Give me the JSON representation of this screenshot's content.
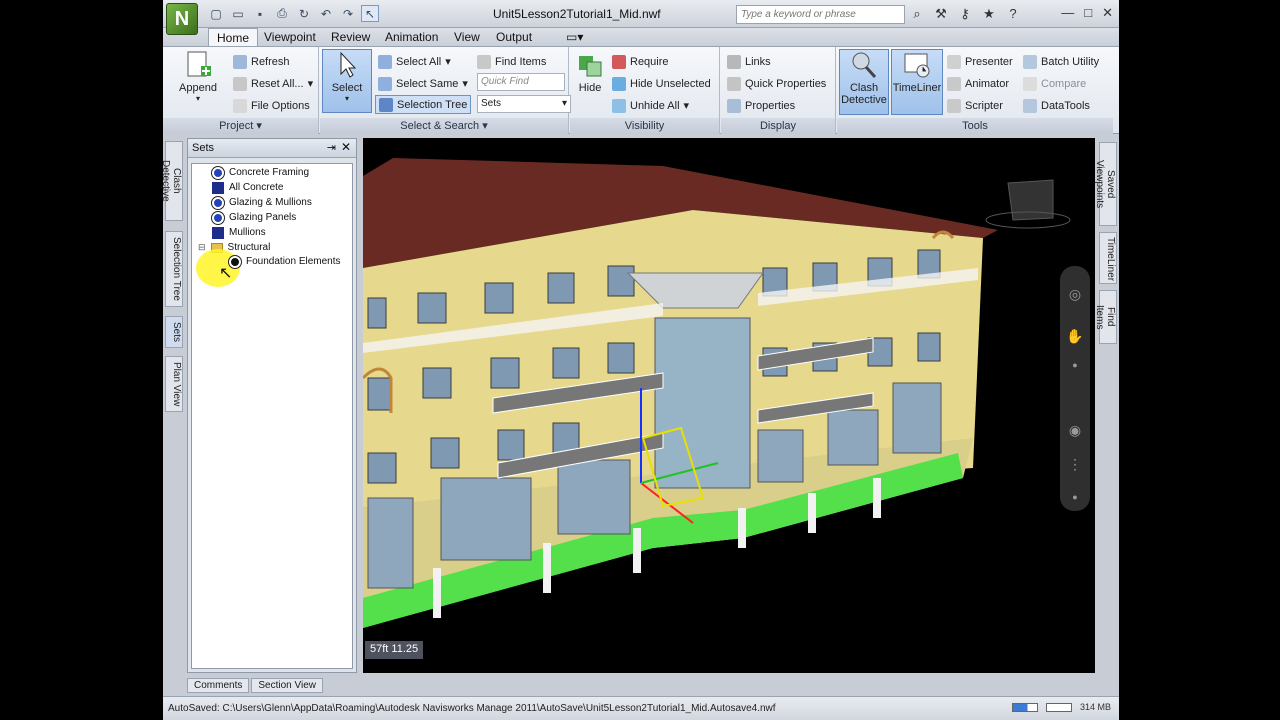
{
  "window": {
    "title": "Unit5Lesson2Tutorial1_Mid.nwf",
    "app_logo": "N",
    "search_placeholder": "Type a keyword or phrase",
    "quick_access": [
      "new-icon",
      "open-icon",
      "save-icon",
      "print-icon",
      "refresh-icon",
      "undo-icon",
      "redo-icon",
      "select-icon"
    ],
    "controls": {
      "minimize": "—",
      "maximize": "□",
      "close": "✕"
    }
  },
  "ribbon": {
    "tabs": [
      "Home",
      "Viewpoint",
      "Review",
      "Animation",
      "View",
      "Output"
    ],
    "active_tab": "Home",
    "panels": {
      "project": {
        "title": "Project",
        "append": "Append",
        "refresh": "Refresh",
        "reset_all": "Reset All...",
        "file_options": "File Options"
      },
      "select_search": {
        "title": "Select & Search",
        "select": "Select",
        "select_all": "Select All",
        "select_same": "Select Same",
        "selection_tree": "Selection Tree",
        "find_items": "Find Items",
        "quick_find_placeholder": "Quick Find",
        "sets": "Sets"
      },
      "visibility": {
        "title": "Visibility",
        "hide": "Hide",
        "require": "Require",
        "hide_unselected": "Hide Unselected",
        "unhide_all": "Unhide All"
      },
      "display": {
        "title": "Display",
        "links": "Links",
        "quick_properties": "Quick Properties",
        "properties": "Properties"
      },
      "tools": {
        "title": "Tools",
        "clash_detective_1": "Clash",
        "clash_detective_2": "Detective",
        "timeliner": "TimeLiner",
        "presenter": "Presenter",
        "animator": "Animator",
        "scripter": "Scripter",
        "batch_utility": "Batch Utility",
        "compare": "Compare",
        "datatools": "DataTools"
      }
    }
  },
  "left_dock_tabs": [
    "Clash Detective",
    "Selection Tree",
    "Sets",
    "Plan View"
  ],
  "sets_panel": {
    "title": "Sets",
    "items": [
      {
        "label": "Concrete Framing",
        "icon": "search-set-icon"
      },
      {
        "label": "All Concrete",
        "icon": "selection-set-icon"
      },
      {
        "label": "Glazing & Mullions",
        "icon": "search-set-icon"
      },
      {
        "label": "Glazing Panels",
        "icon": "search-set-icon"
      },
      {
        "label": "Mullions",
        "icon": "selection-set-icon"
      },
      {
        "label": "Structural",
        "icon": "folder-icon"
      },
      {
        "label": "Foundation Elements",
        "icon": "search-set-icon"
      }
    ]
  },
  "bottom_tabs": [
    "Comments",
    "Section View"
  ],
  "right_dock_tabs": [
    "Saved Viewpoints",
    "TimeLiner",
    "Find Items"
  ],
  "viewport": {
    "coordinate_readout": "57ft 11.25"
  },
  "status_bar": {
    "text": "AutoSaved: C:\\Users\\Glenn\\AppData\\Roaming\\Autodesk Navisworks Manage 2011\\AutoSave\\Unit5Lesson2Tutorial1_Mid.Autosave4.nwf",
    "memory": "314 MB"
  },
  "colors": {
    "facade": "#e6d88c",
    "roof": "#6a2a24",
    "highlight_green": "#53e04a",
    "window_glass": "#8ea7bd",
    "accent_blue": "#3d7ad6"
  }
}
